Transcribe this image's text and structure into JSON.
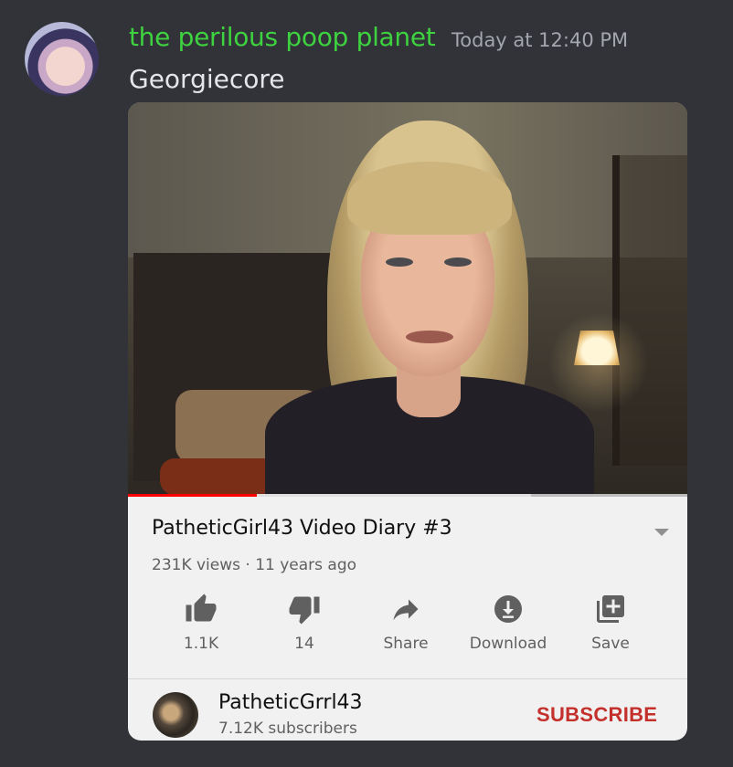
{
  "message": {
    "username": "the perilous poop planet",
    "timestamp": "Today at 12:40 PM",
    "text": "Georgiecore",
    "username_color": "#3ed240"
  },
  "embed": {
    "video": {
      "title": "PatheticGirl43 Video Diary #3",
      "meta": "231K views · 11 years ago",
      "progress_fraction": 0.23,
      "buffer_fraction": 0.72
    },
    "actions": [
      {
        "name": "like",
        "icon": "thumbs-up-icon",
        "label": "1.1K"
      },
      {
        "name": "dislike",
        "icon": "thumbs-down-icon",
        "label": "14"
      },
      {
        "name": "share",
        "icon": "share-arrow-icon",
        "label": "Share"
      },
      {
        "name": "download",
        "icon": "download-icon",
        "label": "Download"
      },
      {
        "name": "save",
        "icon": "playlist-add-icon",
        "label": "Save"
      }
    ],
    "channel": {
      "name": "PatheticGrrl43",
      "subscribers": "7.12K subscribers",
      "subscribe_label": "SUBSCRIBE",
      "subscribe_color": "#c4302b"
    }
  }
}
